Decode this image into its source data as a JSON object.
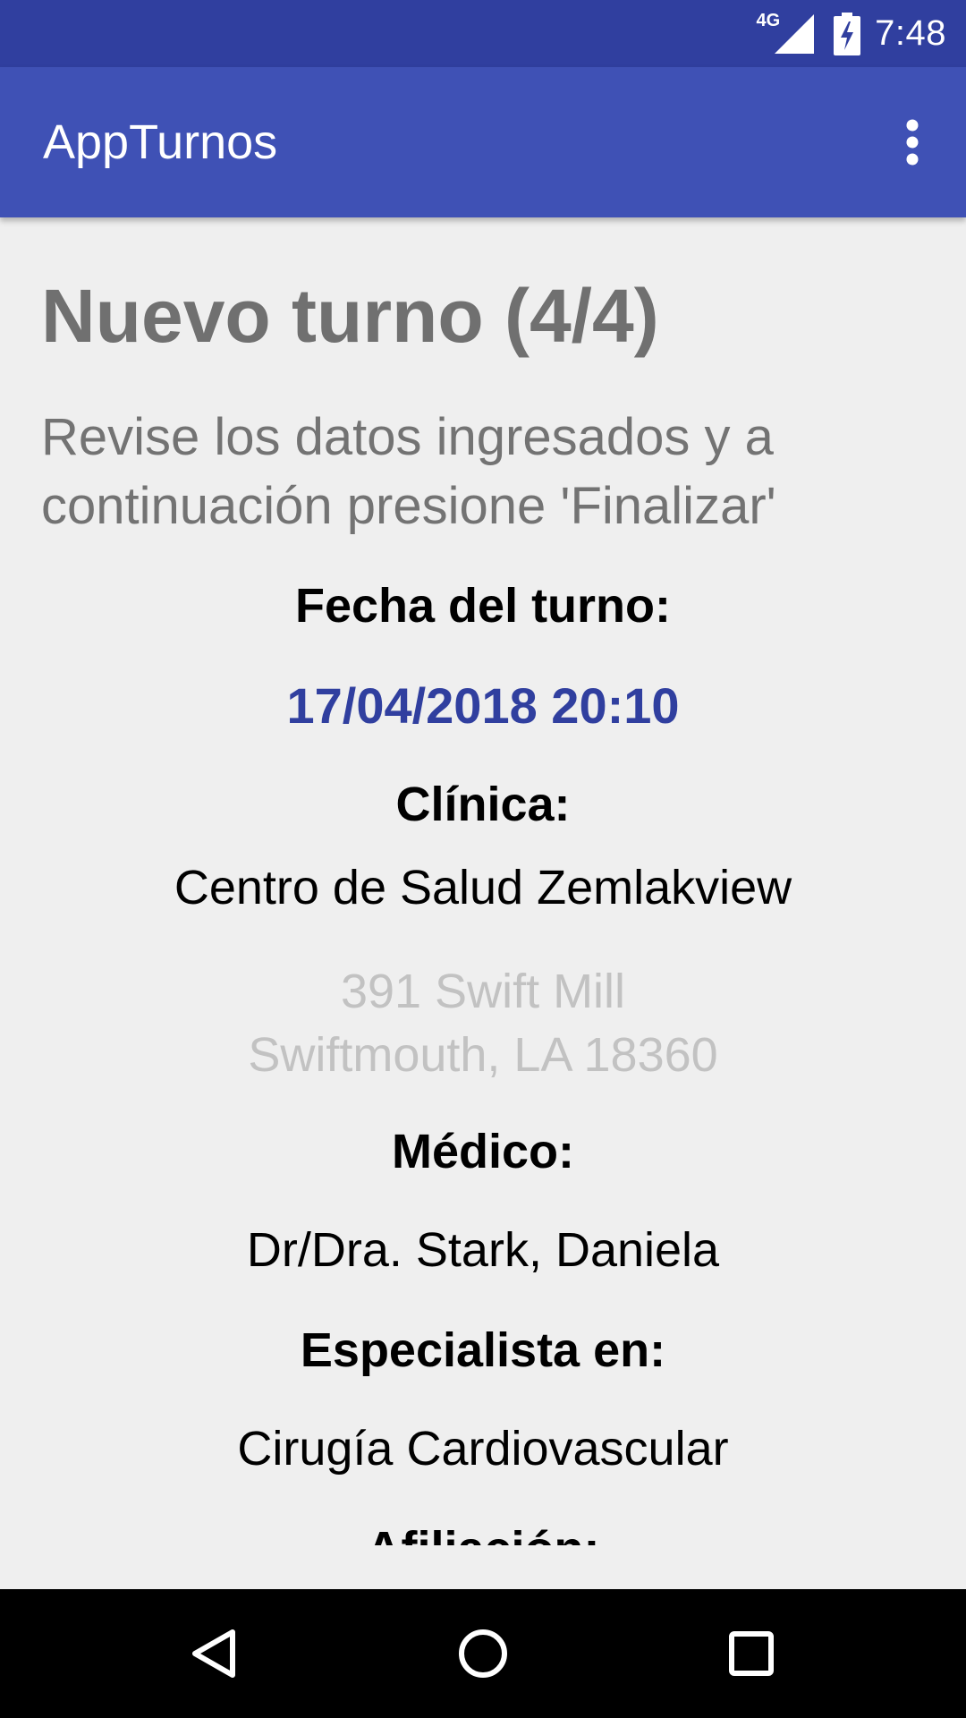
{
  "status_bar": {
    "network": "4G",
    "time": "7:48",
    "icons": [
      "signal-icon",
      "battery-charging-icon"
    ],
    "background": "#303f9f"
  },
  "app_bar": {
    "title": "AppTurnos",
    "menu_icon": "more-vert-icon",
    "background": "#3f51b5"
  },
  "content": {
    "heading": "Nuevo turno (4/4)",
    "instructions": "Revise los datos ingresados y a continuación presione 'Finalizar'",
    "fecha_label": "Fecha del turno:",
    "fecha_value": "17/04/2018 20:10",
    "clinica_label": "Clínica:",
    "clinica_name": "Centro de Salud Zemlakview",
    "clinica_address_line1": "391 Swift Mill",
    "clinica_address_line2": "Swiftmouth, LA 18360",
    "medico_label": "Médico:",
    "medico_name": "Dr/Dra. Stark, Daniela",
    "especialidad_label": "Especialista en:",
    "especialidad_value": "Cirugía Cardiovascular",
    "afiliacion_label": "Afiliación:"
  },
  "colors": {
    "accent": "#303f9f",
    "heading_gray": "#707070",
    "address_gray": "#c2c2c2"
  },
  "nav_bar": {
    "icons": [
      "back-icon",
      "home-icon",
      "recents-icon"
    ]
  }
}
